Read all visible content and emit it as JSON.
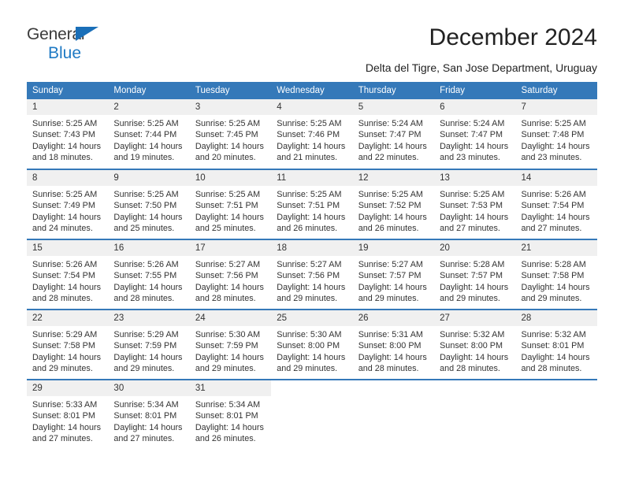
{
  "brand": {
    "name_part1": "General",
    "name_part2": "Blue",
    "triangle_color": "#1a6fb8",
    "text_color": "#3b3b3b",
    "blue_text_color": "#1f7ac4"
  },
  "header": {
    "title": "December 2024",
    "subtitle": "Delta del Tigre, San Jose Department, Uruguay"
  },
  "colors": {
    "header_band": "#3579b9",
    "daynum_band": "#f0f0f0",
    "row_divider": "#3579b9",
    "body_text": "#333333"
  },
  "weekday_headers": [
    "Sunday",
    "Monday",
    "Tuesday",
    "Wednesday",
    "Thursday",
    "Friday",
    "Saturday"
  ],
  "weeks": [
    [
      {
        "day": "1",
        "sunrise": "Sunrise: 5:25 AM",
        "sunset": "Sunset: 7:43 PM",
        "daylight_line1": "Daylight: 14 hours",
        "daylight_line2": "and 18 minutes."
      },
      {
        "day": "2",
        "sunrise": "Sunrise: 5:25 AM",
        "sunset": "Sunset: 7:44 PM",
        "daylight_line1": "Daylight: 14 hours",
        "daylight_line2": "and 19 minutes."
      },
      {
        "day": "3",
        "sunrise": "Sunrise: 5:25 AM",
        "sunset": "Sunset: 7:45 PM",
        "daylight_line1": "Daylight: 14 hours",
        "daylight_line2": "and 20 minutes."
      },
      {
        "day": "4",
        "sunrise": "Sunrise: 5:25 AM",
        "sunset": "Sunset: 7:46 PM",
        "daylight_line1": "Daylight: 14 hours",
        "daylight_line2": "and 21 minutes."
      },
      {
        "day": "5",
        "sunrise": "Sunrise: 5:24 AM",
        "sunset": "Sunset: 7:47 PM",
        "daylight_line1": "Daylight: 14 hours",
        "daylight_line2": "and 22 minutes."
      },
      {
        "day": "6",
        "sunrise": "Sunrise: 5:24 AM",
        "sunset": "Sunset: 7:47 PM",
        "daylight_line1": "Daylight: 14 hours",
        "daylight_line2": "and 23 minutes."
      },
      {
        "day": "7",
        "sunrise": "Sunrise: 5:25 AM",
        "sunset": "Sunset: 7:48 PM",
        "daylight_line1": "Daylight: 14 hours",
        "daylight_line2": "and 23 minutes."
      }
    ],
    [
      {
        "day": "8",
        "sunrise": "Sunrise: 5:25 AM",
        "sunset": "Sunset: 7:49 PM",
        "daylight_line1": "Daylight: 14 hours",
        "daylight_line2": "and 24 minutes."
      },
      {
        "day": "9",
        "sunrise": "Sunrise: 5:25 AM",
        "sunset": "Sunset: 7:50 PM",
        "daylight_line1": "Daylight: 14 hours",
        "daylight_line2": "and 25 minutes."
      },
      {
        "day": "10",
        "sunrise": "Sunrise: 5:25 AM",
        "sunset": "Sunset: 7:51 PM",
        "daylight_line1": "Daylight: 14 hours",
        "daylight_line2": "and 25 minutes."
      },
      {
        "day": "11",
        "sunrise": "Sunrise: 5:25 AM",
        "sunset": "Sunset: 7:51 PM",
        "daylight_line1": "Daylight: 14 hours",
        "daylight_line2": "and 26 minutes."
      },
      {
        "day": "12",
        "sunrise": "Sunrise: 5:25 AM",
        "sunset": "Sunset: 7:52 PM",
        "daylight_line1": "Daylight: 14 hours",
        "daylight_line2": "and 26 minutes."
      },
      {
        "day": "13",
        "sunrise": "Sunrise: 5:25 AM",
        "sunset": "Sunset: 7:53 PM",
        "daylight_line1": "Daylight: 14 hours",
        "daylight_line2": "and 27 minutes."
      },
      {
        "day": "14",
        "sunrise": "Sunrise: 5:26 AM",
        "sunset": "Sunset: 7:54 PM",
        "daylight_line1": "Daylight: 14 hours",
        "daylight_line2": "and 27 minutes."
      }
    ],
    [
      {
        "day": "15",
        "sunrise": "Sunrise: 5:26 AM",
        "sunset": "Sunset: 7:54 PM",
        "daylight_line1": "Daylight: 14 hours",
        "daylight_line2": "and 28 minutes."
      },
      {
        "day": "16",
        "sunrise": "Sunrise: 5:26 AM",
        "sunset": "Sunset: 7:55 PM",
        "daylight_line1": "Daylight: 14 hours",
        "daylight_line2": "and 28 minutes."
      },
      {
        "day": "17",
        "sunrise": "Sunrise: 5:27 AM",
        "sunset": "Sunset: 7:56 PM",
        "daylight_line1": "Daylight: 14 hours",
        "daylight_line2": "and 28 minutes."
      },
      {
        "day": "18",
        "sunrise": "Sunrise: 5:27 AM",
        "sunset": "Sunset: 7:56 PM",
        "daylight_line1": "Daylight: 14 hours",
        "daylight_line2": "and 29 minutes."
      },
      {
        "day": "19",
        "sunrise": "Sunrise: 5:27 AM",
        "sunset": "Sunset: 7:57 PM",
        "daylight_line1": "Daylight: 14 hours",
        "daylight_line2": "and 29 minutes."
      },
      {
        "day": "20",
        "sunrise": "Sunrise: 5:28 AM",
        "sunset": "Sunset: 7:57 PM",
        "daylight_line1": "Daylight: 14 hours",
        "daylight_line2": "and 29 minutes."
      },
      {
        "day": "21",
        "sunrise": "Sunrise: 5:28 AM",
        "sunset": "Sunset: 7:58 PM",
        "daylight_line1": "Daylight: 14 hours",
        "daylight_line2": "and 29 minutes."
      }
    ],
    [
      {
        "day": "22",
        "sunrise": "Sunrise: 5:29 AM",
        "sunset": "Sunset: 7:58 PM",
        "daylight_line1": "Daylight: 14 hours",
        "daylight_line2": "and 29 minutes."
      },
      {
        "day": "23",
        "sunrise": "Sunrise: 5:29 AM",
        "sunset": "Sunset: 7:59 PM",
        "daylight_line1": "Daylight: 14 hours",
        "daylight_line2": "and 29 minutes."
      },
      {
        "day": "24",
        "sunrise": "Sunrise: 5:30 AM",
        "sunset": "Sunset: 7:59 PM",
        "daylight_line1": "Daylight: 14 hours",
        "daylight_line2": "and 29 minutes."
      },
      {
        "day": "25",
        "sunrise": "Sunrise: 5:30 AM",
        "sunset": "Sunset: 8:00 PM",
        "daylight_line1": "Daylight: 14 hours",
        "daylight_line2": "and 29 minutes."
      },
      {
        "day": "26",
        "sunrise": "Sunrise: 5:31 AM",
        "sunset": "Sunset: 8:00 PM",
        "daylight_line1": "Daylight: 14 hours",
        "daylight_line2": "and 28 minutes."
      },
      {
        "day": "27",
        "sunrise": "Sunrise: 5:32 AM",
        "sunset": "Sunset: 8:00 PM",
        "daylight_line1": "Daylight: 14 hours",
        "daylight_line2": "and 28 minutes."
      },
      {
        "day": "28",
        "sunrise": "Sunrise: 5:32 AM",
        "sunset": "Sunset: 8:01 PM",
        "daylight_line1": "Daylight: 14 hours",
        "daylight_line2": "and 28 minutes."
      }
    ],
    [
      {
        "day": "29",
        "sunrise": "Sunrise: 5:33 AM",
        "sunset": "Sunset: 8:01 PM",
        "daylight_line1": "Daylight: 14 hours",
        "daylight_line2": "and 27 minutes."
      },
      {
        "day": "30",
        "sunrise": "Sunrise: 5:34 AM",
        "sunset": "Sunset: 8:01 PM",
        "daylight_line1": "Daylight: 14 hours",
        "daylight_line2": "and 27 minutes."
      },
      {
        "day": "31",
        "sunrise": "Sunrise: 5:34 AM",
        "sunset": "Sunset: 8:01 PM",
        "daylight_line1": "Daylight: 14 hours",
        "daylight_line2": "and 26 minutes."
      },
      {
        "day": "",
        "sunrise": "",
        "sunset": "",
        "daylight_line1": "",
        "daylight_line2": ""
      },
      {
        "day": "",
        "sunrise": "",
        "sunset": "",
        "daylight_line1": "",
        "daylight_line2": ""
      },
      {
        "day": "",
        "sunrise": "",
        "sunset": "",
        "daylight_line1": "",
        "daylight_line2": ""
      },
      {
        "day": "",
        "sunrise": "",
        "sunset": "",
        "daylight_line1": "",
        "daylight_line2": ""
      }
    ]
  ]
}
